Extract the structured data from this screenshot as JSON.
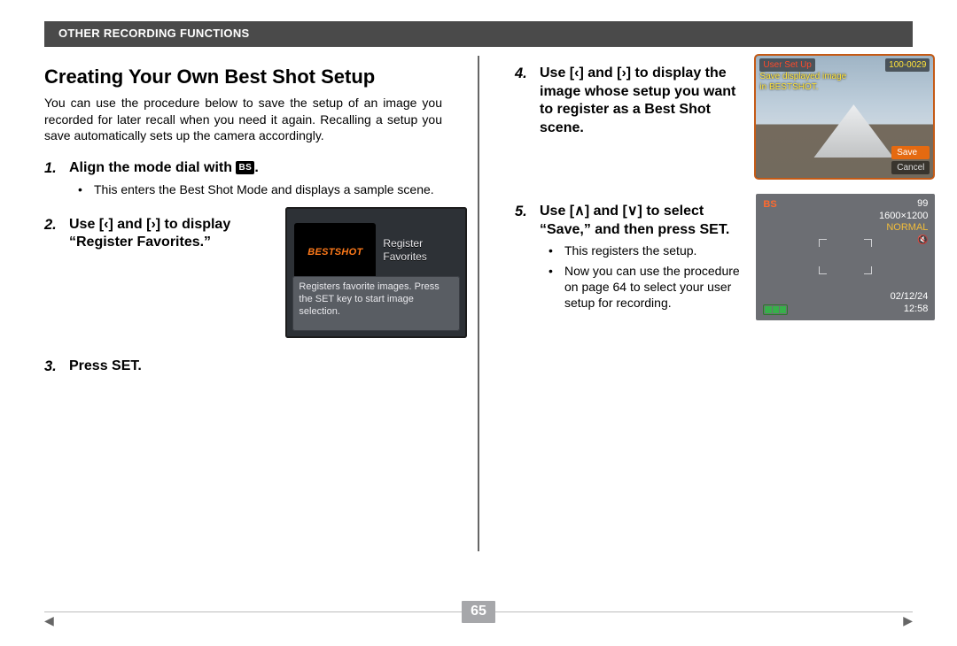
{
  "header": {
    "section": "OTHER RECORDING FUNCTIONS"
  },
  "page_number": "65",
  "title": "Creating Your Own Best Shot Setup",
  "intro": "You can use the procedure below to save the setup of an image you recorded for later recall when you need it again. Recalling a setup you save automatically sets up the camera accordingly.",
  "bs_chip": "BS",
  "steps": {
    "s1": {
      "num": "1.",
      "body_pre": "Align the mode dial with ",
      "body_post": ".",
      "bullet": "This enters the Best Shot Mode and displays a sample scene."
    },
    "s2": {
      "num": "2.",
      "body": "Use [‹] and [›] to display “Register Favorites.”"
    },
    "s3": {
      "num": "3.",
      "body": "Press SET."
    },
    "s4": {
      "num": "4.",
      "body": "Use [‹] and [›] to display the image whose setup you want to register as a Best Shot scene."
    },
    "s5": {
      "num": "5.",
      "body": "Use [∧] and [∨] to select “Save,” and then press SET.",
      "bullet1": "This registers the setup.",
      "bullet2": "Now you can use the procedure on page 64 to select your user setup for recording."
    }
  },
  "lcd1": {
    "logo": "BESTSHOT",
    "label1": "Register",
    "label2": "Favorites",
    "desc": "Registers favorite images. Press the SET key to start image selection."
  },
  "lcd2": {
    "title": "User Set Up",
    "counter": "100-0029",
    "caption1": "Save displayed image",
    "caption2": "in BESTSHOT.",
    "opt_save": "Save",
    "opt_cancel": "Cancel"
  },
  "lcd3": {
    "bs": "BS",
    "shots": "99",
    "res": "1600×1200",
    "normal": "NORMAL",
    "date": "02/12/24",
    "time": "12:58"
  }
}
